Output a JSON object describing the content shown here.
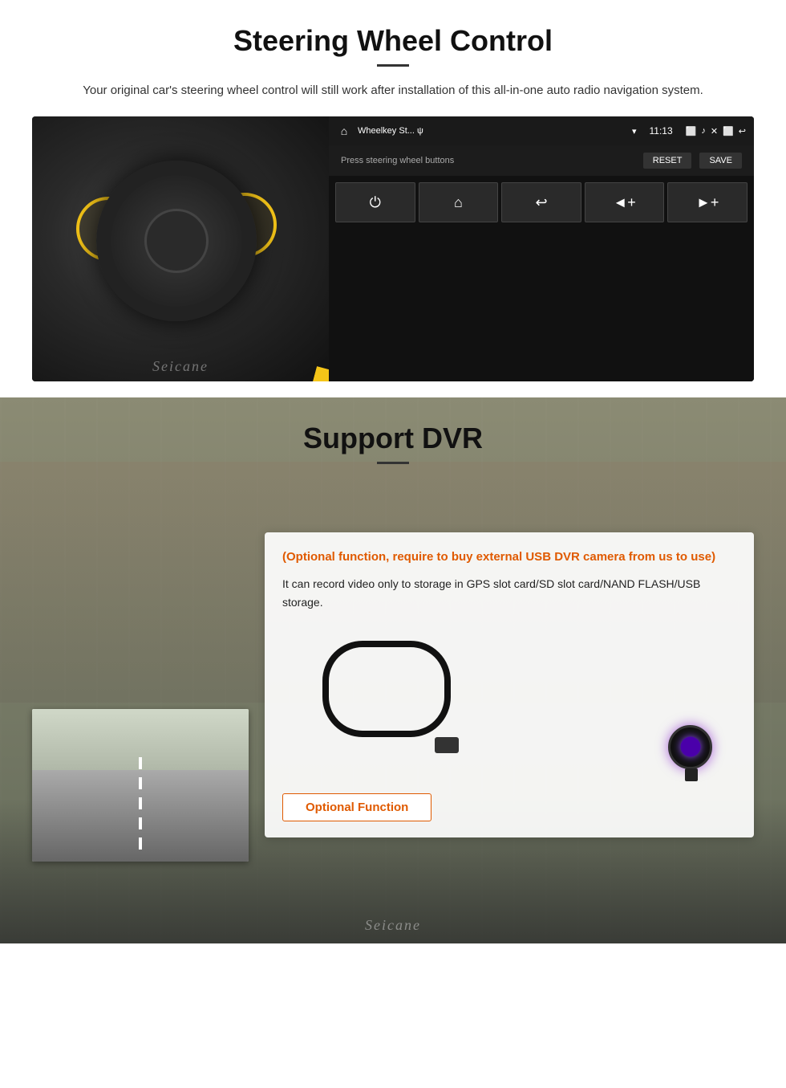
{
  "steering": {
    "title": "Steering Wheel Control",
    "subtitle": "Your original car's steering wheel control will still work after installation of this all-in-one auto radio navigation system.",
    "headunit": {
      "app_name": "Wheelkey St... ψ",
      "time": "11:13",
      "prompt": "Press steering wheel buttons",
      "btn_reset": "RESET",
      "btn_save": "SAVE",
      "buttons": [
        {
          "icon": "⏻",
          "label": "power"
        },
        {
          "icon": "⌂",
          "label": "home"
        },
        {
          "icon": "↩",
          "label": "back"
        },
        {
          "icon": "◄+",
          "label": "vol-down"
        },
        {
          "icon": "►+",
          "label": "vol-up"
        }
      ]
    },
    "watermark": "Seicane"
  },
  "dvr": {
    "title": "Support DVR",
    "info": {
      "optional_text": "(Optional function, require to buy external USB DVR camera from us to use)",
      "description": "It can record video only to storage in GPS slot card/SD slot card/NAND FLASH/USB storage."
    },
    "optional_button_label": "Optional Function",
    "watermark": "Seicane"
  }
}
